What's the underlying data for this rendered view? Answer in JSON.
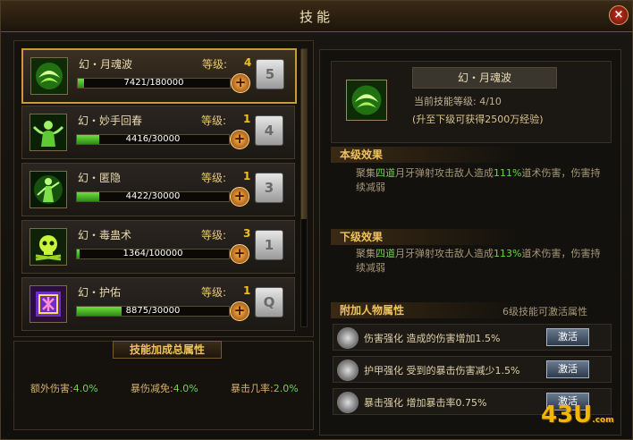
{
  "window": {
    "title": "技能",
    "close": "×"
  },
  "skills": [
    {
      "name": "幻・月魂波",
      "level_label": "等级:",
      "level": "4",
      "level_color": "#f0c020",
      "progress": "7421/180000",
      "progress_fraction": 0.041,
      "key": "5",
      "icon": "crescent-wave-icon"
    },
    {
      "name": "幻・妙手回春",
      "level_label": "等级:",
      "level": "1",
      "level_color": "#f0c020",
      "progress": "4416/30000",
      "progress_fraction": 0.147,
      "key": "4",
      "icon": "healing-figure-icon"
    },
    {
      "name": "幻・匿隐",
      "level_label": "等级:",
      "level": "1",
      "level_color": "#f0c020",
      "progress": "4422/30000",
      "progress_fraction": 0.147,
      "key": "3",
      "icon": "stealth-figure-icon"
    },
    {
      "name": "幻・毒蛊术",
      "level_label": "等级:",
      "level": "3",
      "level_color": "#f0c020",
      "progress": "1364/100000",
      "progress_fraction": 0.014,
      "key": "1",
      "icon": "poison-skull-icon"
    },
    {
      "name": "幻・护佑",
      "level_label": "等级:",
      "level": "1",
      "level_color": "#f0c020",
      "progress": "8875/30000",
      "progress_fraction": 0.296,
      "key": "Q",
      "icon": "protect-rune-icon"
    }
  ],
  "summary": {
    "title": "技能加成总属性",
    "stats": [
      {
        "label": "额外伤害:",
        "value": "4.0%"
      },
      {
        "label": "暴伤减免:",
        "value": "4.0%"
      },
      {
        "label": "暴击几率:",
        "value": "2.0%"
      }
    ]
  },
  "detail": {
    "name": "幻・月魂波",
    "current_level": "当前技能等级: 4/10",
    "upgrade_hint": "(升至下级可获得2500万经验)",
    "this_level_title": "本级效果",
    "this_level_desc": {
      "a": "聚集",
      "b": "四道",
      "c": "月牙弹射攻击敌人造成",
      "d": "111%",
      "e": "道术伤害，伤害持续减弱"
    },
    "next_level_title": "下级效果",
    "next_level_desc": {
      "a": "聚集",
      "b": "四道",
      "c": "月牙弹射攻击敌人造成",
      "d": "113%",
      "e": "道术伤害，伤害持续减弱"
    },
    "attr_title": "附加人物属性",
    "attr_note": "6级技能可激活属性",
    "attrs": [
      {
        "name": "伤害强化",
        "desc": "造成的伤害增加1.5%",
        "button": "激活"
      },
      {
        "name": "护甲强化",
        "desc": "受到的暴击伤害减少1.5%",
        "button": "激活"
      },
      {
        "name": "暴击强化",
        "desc": "增加暴击率0.75%",
        "button": "激活"
      }
    ]
  },
  "watermark": {
    "text": "43U",
    "sub": ".com"
  }
}
